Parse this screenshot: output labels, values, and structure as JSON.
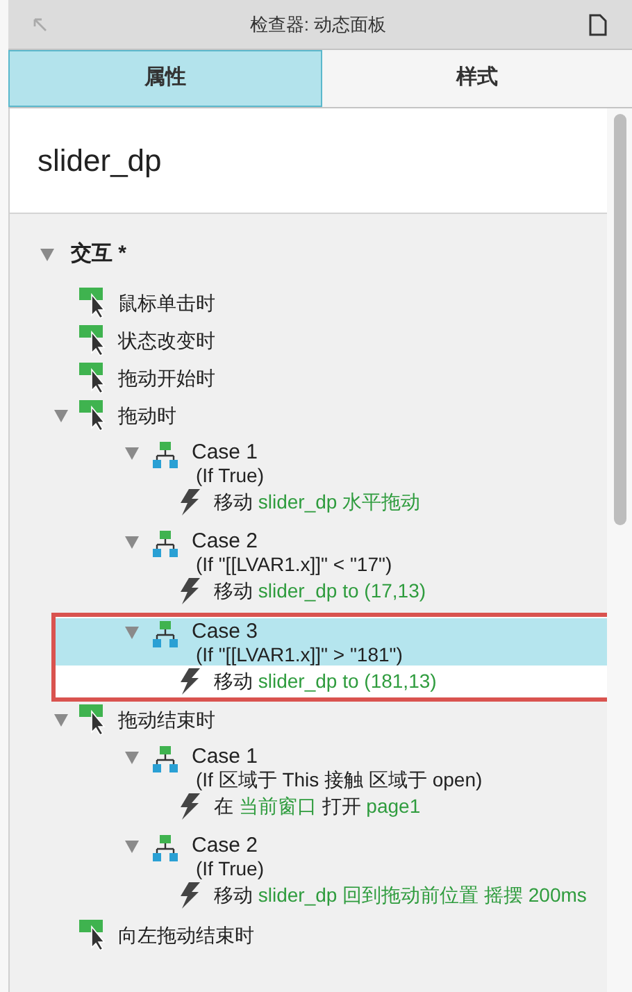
{
  "window": {
    "title": "检查器: 动态面板"
  },
  "tabs": [
    {
      "label": "属性",
      "selected": true
    },
    {
      "label": "样式",
      "selected": false
    }
  ],
  "widget_name": "slider_dp",
  "section": {
    "title": "交互 *",
    "expanded": true
  },
  "events": [
    {
      "label": "鼠标单击时"
    },
    {
      "label": "状态改变时"
    },
    {
      "label": "拖动开始时"
    },
    {
      "label": "拖动时",
      "expanded": true,
      "cases": [
        {
          "name": "Case 1",
          "condition": "(If True)",
          "expanded": true,
          "selected": false,
          "actions": [
            [
              {
                "kind": "verb",
                "text": "移动"
              },
              {
                "kind": "target",
                "text": "slider_dp 水平拖动"
              }
            ]
          ]
        },
        {
          "name": "Case 2",
          "condition": "(If \"[[LVAR1.x]]\" < \"17\")",
          "expanded": true,
          "selected": false,
          "actions": [
            [
              {
                "kind": "verb",
                "text": "移动"
              },
              {
                "kind": "target",
                "text": "slider_dp to (17,13)"
              }
            ]
          ]
        },
        {
          "name": "Case 3",
          "condition": "(If \"[[LVAR1.x]]\" > \"181\")",
          "expanded": true,
          "selected": true,
          "actions": [
            [
              {
                "kind": "verb",
                "text": "移动"
              },
              {
                "kind": "target",
                "text": "slider_dp to (181,13)"
              }
            ]
          ]
        }
      ]
    },
    {
      "label": "拖动结束时",
      "expanded": true,
      "cases": [
        {
          "name": "Case 1",
          "condition": "(If 区域于 This 接触 区域于 open)",
          "expanded": true,
          "selected": false,
          "actions": [
            [
              {
                "kind": "verb",
                "text": "在"
              },
              {
                "kind": "target",
                "text": "当前窗口"
              },
              {
                "kind": "verb",
                "text": "打开"
              },
              {
                "kind": "target",
                "text": "page1"
              }
            ]
          ]
        },
        {
          "name": "Case 2",
          "condition": "(If True)",
          "expanded": true,
          "selected": false,
          "actions": [
            [
              {
                "kind": "verb",
                "text": "移动"
              },
              {
                "kind": "target",
                "text": "slider_dp 回到拖动前位置 摇摆 200ms"
              }
            ]
          ]
        }
      ]
    },
    {
      "label": "向左拖动结束时"
    }
  ]
}
